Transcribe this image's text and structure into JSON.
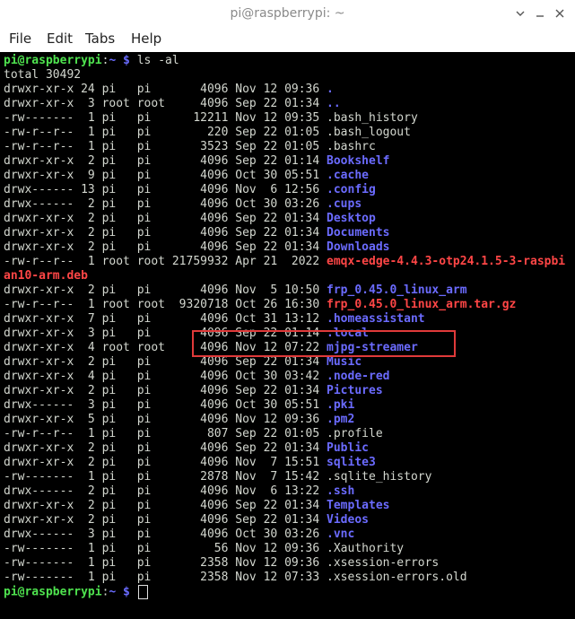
{
  "window": {
    "title": "pi@raspberrypi: ~"
  },
  "window_buttons": [
    "chevron-down-icon",
    "minimize-icon",
    "close-icon"
  ],
  "menubar": {
    "items": [
      "File",
      "Edit",
      "Tabs",
      "Help"
    ]
  },
  "colors": {
    "prompt_user": "#4fe34f",
    "prompt_path": "#6a6cff",
    "directory": "#6b6bff",
    "archive": "#ff4646",
    "plain": "#d3d7cf",
    "highlight_box": "#e03a3a"
  },
  "terminal": {
    "lines": [
      [
        {
          "t": "pi@raspberrypi",
          "c": "prompt-user"
        },
        {
          "t": ":",
          "c": "plain"
        },
        {
          "t": "~ $",
          "c": "prompt-path"
        },
        {
          "t": " ls -al",
          "c": "plain"
        }
      ],
      [
        {
          "t": "total 30492",
          "c": "plain"
        }
      ],
      [
        {
          "t": "drwxr-xr-x 24 pi   pi       4096 Nov 12 09:36 ",
          "c": "plain"
        },
        {
          "t": ".",
          "c": "dir"
        }
      ],
      [
        {
          "t": "drwxr-xr-x  3 root root     4096 Sep 22 01:34 ",
          "c": "plain"
        },
        {
          "t": "..",
          "c": "dir"
        }
      ],
      [
        {
          "t": "-rw-------  1 pi   pi      12211 Nov 12 09:35 .bash_history",
          "c": "plain"
        }
      ],
      [
        {
          "t": "-rw-r--r--  1 pi   pi        220 Sep 22 01:05 .bash_logout",
          "c": "plain"
        }
      ],
      [
        {
          "t": "-rw-r--r--  1 pi   pi       3523 Sep 22 01:05 .bashrc",
          "c": "plain"
        }
      ],
      [
        {
          "t": "drwxr-xr-x  2 pi   pi       4096 Sep 22 01:14 ",
          "c": "plain"
        },
        {
          "t": "Bookshelf",
          "c": "dir"
        }
      ],
      [
        {
          "t": "drwxr-xr-x  9 pi   pi       4096 Oct 30 05:51 ",
          "c": "plain"
        },
        {
          "t": ".cache",
          "c": "dir"
        }
      ],
      [
        {
          "t": "drwx------ 13 pi   pi       4096 Nov  6 12:56 ",
          "c": "plain"
        },
        {
          "t": ".config",
          "c": "dir"
        }
      ],
      [
        {
          "t": "drwx------  2 pi   pi       4096 Oct 30 03:26 ",
          "c": "plain"
        },
        {
          "t": ".cups",
          "c": "dir"
        }
      ],
      [
        {
          "t": "drwxr-xr-x  2 pi   pi       4096 Sep 22 01:34 ",
          "c": "plain"
        },
        {
          "t": "Desktop",
          "c": "dir"
        }
      ],
      [
        {
          "t": "drwxr-xr-x  2 pi   pi       4096 Sep 22 01:34 ",
          "c": "plain"
        },
        {
          "t": "Documents",
          "c": "dir"
        }
      ],
      [
        {
          "t": "drwxr-xr-x  2 pi   pi       4096 Sep 22 01:34 ",
          "c": "plain"
        },
        {
          "t": "Downloads",
          "c": "dir"
        }
      ],
      [
        {
          "t": "-rw-r--r--  1 root root 21759932 Apr 21  2022 ",
          "c": "plain"
        },
        {
          "t": "emqx-edge-4.4.3-otp24.1.5-3-raspbi",
          "c": "archive"
        }
      ],
      [
        {
          "t": "an10-arm.deb",
          "c": "archive"
        }
      ],
      [
        {
          "t": "drwxr-xr-x  2 pi   pi       4096 Nov  5 10:50 ",
          "c": "plain"
        },
        {
          "t": "frp_0.45.0_linux_arm",
          "c": "dir"
        }
      ],
      [
        {
          "t": "-rw-r--r--  1 root root  9320718 Oct 26 16:30 ",
          "c": "plain"
        },
        {
          "t": "frp_0.45.0_linux_arm.tar.gz",
          "c": "archive"
        }
      ],
      [
        {
          "t": "drwxr-xr-x  7 pi   pi       4096 Oct 31 13:12 ",
          "c": "plain"
        },
        {
          "t": ".homeassistant",
          "c": "dir"
        }
      ],
      [
        {
          "t": "drwxr-xr-x  3 pi   pi       4096 Sep 22 01:14 ",
          "c": "plain"
        },
        {
          "t": ".local",
          "c": "dir"
        }
      ],
      [
        {
          "t": "drwxr-xr-x  4 root root     4096 Nov 12 07:22 ",
          "c": "plain"
        },
        {
          "t": "mjpg-streamer",
          "c": "dir"
        }
      ],
      [
        {
          "t": "drwxr-xr-x  2 pi   pi       4096 Sep 22 01:34 ",
          "c": "plain"
        },
        {
          "t": "Music",
          "c": "dir"
        }
      ],
      [
        {
          "t": "drwxr-xr-x  4 pi   pi       4096 Oct 30 03:42 ",
          "c": "plain"
        },
        {
          "t": ".node-red",
          "c": "dir"
        }
      ],
      [
        {
          "t": "drwxr-xr-x  2 pi   pi       4096 Sep 22 01:34 ",
          "c": "plain"
        },
        {
          "t": "Pictures",
          "c": "dir"
        }
      ],
      [
        {
          "t": "drwx------  3 pi   pi       4096 Oct 30 05:51 ",
          "c": "plain"
        },
        {
          "t": ".pki",
          "c": "dir"
        }
      ],
      [
        {
          "t": "drwxr-xr-x  5 pi   pi       4096 Nov 12 09:36 ",
          "c": "plain"
        },
        {
          "t": ".pm2",
          "c": "dir"
        }
      ],
      [
        {
          "t": "-rw-r--r--  1 pi   pi        807 Sep 22 01:05 .profile",
          "c": "plain"
        }
      ],
      [
        {
          "t": "drwxr-xr-x  2 pi   pi       4096 Sep 22 01:34 ",
          "c": "plain"
        },
        {
          "t": "Public",
          "c": "dir"
        }
      ],
      [
        {
          "t": "drwxr-xr-x  2 pi   pi       4096 Nov  7 15:51 ",
          "c": "plain"
        },
        {
          "t": "sqlite3",
          "c": "dir"
        }
      ],
      [
        {
          "t": "-rw-------  1 pi   pi       2878 Nov  7 15:42 .sqlite_history",
          "c": "plain"
        }
      ],
      [
        {
          "t": "drwx------  2 pi   pi       4096 Nov  6 13:22 ",
          "c": "plain"
        },
        {
          "t": ".ssh",
          "c": "dir"
        }
      ],
      [
        {
          "t": "drwxr-xr-x  2 pi   pi       4096 Sep 22 01:34 ",
          "c": "plain"
        },
        {
          "t": "Templates",
          "c": "dir"
        }
      ],
      [
        {
          "t": "drwxr-xr-x  2 pi   pi       4096 Sep 22 01:34 ",
          "c": "plain"
        },
        {
          "t": "Videos",
          "c": "dir"
        }
      ],
      [
        {
          "t": "drwx------  3 pi   pi       4096 Oct 30 03:26 ",
          "c": "plain"
        },
        {
          "t": ".vnc",
          "c": "dir"
        }
      ],
      [
        {
          "t": "-rw-------  1 pi   pi         56 Nov 12 09:36 .Xauthority",
          "c": "plain"
        }
      ],
      [
        {
          "t": "-rw-------  1 pi   pi       2358 Nov 12 09:36 .xsession-errors",
          "c": "plain"
        }
      ],
      [
        {
          "t": "-rw-------  1 pi   pi       2358 Nov 12 07:33 .xsession-errors.old",
          "c": "plain"
        }
      ],
      [
        {
          "t": "pi@raspberrypi",
          "c": "prompt-user"
        },
        {
          "t": ":",
          "c": "plain"
        },
        {
          "t": "~ $",
          "c": "prompt-path"
        },
        {
          "t": " ",
          "c": "plain"
        }
      ]
    ]
  }
}
